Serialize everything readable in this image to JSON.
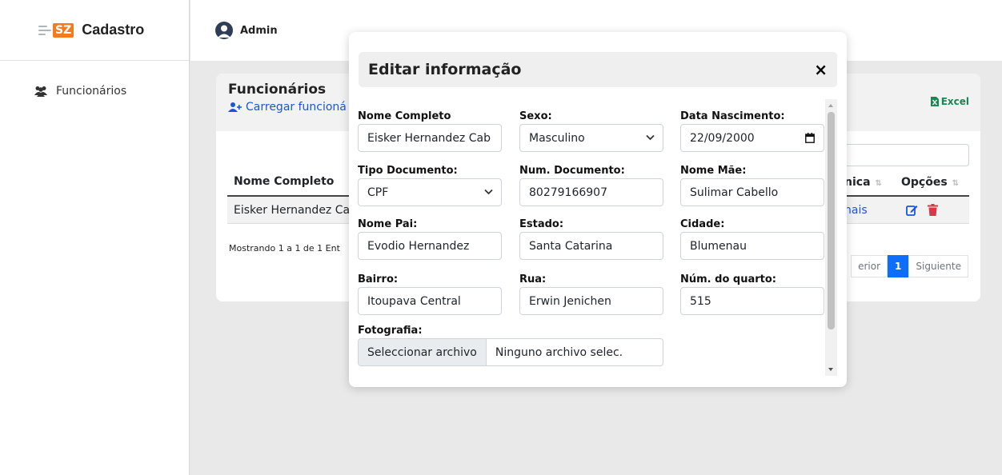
{
  "sidebar": {
    "brand_logo": "SZ",
    "brand_name": "Cadastro",
    "nav_items": [
      {
        "label": "Funcionários",
        "icon": "users-icon"
      }
    ]
  },
  "topbar": {
    "user_label": "Admin"
  },
  "card": {
    "title": "Funcionários",
    "upload_link": "Carregar funcioná",
    "excel_label": "Excel",
    "table": {
      "columns": [
        "Nome Completo",
        "nica",
        "Opções"
      ],
      "rows": [
        {
          "name": "Eisker Hernandez Ca",
          "tecnica": "nais"
        }
      ]
    },
    "info_text": "Mostrando 1 a 1 de 1 Ent",
    "pagination": {
      "previous": "erior",
      "current": "1",
      "next": "Siguiente"
    }
  },
  "modal": {
    "title": "Editar informação",
    "close_symbol": "×",
    "fields": {
      "nome_completo": {
        "label": "Nome Completo",
        "value": "Eisker Hernandez Cab"
      },
      "sexo": {
        "label": "Sexo:",
        "value": "Masculino"
      },
      "data_nascimento": {
        "label": "Data Nascimento:",
        "value": "22/09/2000"
      },
      "tipo_documento": {
        "label": "Tipo Documento:",
        "value": "CPF"
      },
      "num_documento": {
        "label": "Num. Documento:",
        "value": "80279166907"
      },
      "nome_mae": {
        "label": "Nome Mãe:",
        "value": "Sulimar Cabello"
      },
      "nome_pai": {
        "label": "Nome Pai:",
        "value": "Evodio Hernandez"
      },
      "estado": {
        "label": "Estado:",
        "value": "Santa Catarina"
      },
      "cidade": {
        "label": "Cidade:",
        "value": "Blumenau"
      },
      "bairro": {
        "label": "Bairro:",
        "value": "Itoupava Central"
      },
      "rua": {
        "label": "Rua:",
        "value": "Erwin Jenichen"
      },
      "num_quarto": {
        "label": "Núm. do quarto:",
        "value": "515"
      },
      "fotografia": {
        "label": "Fotografia:",
        "button": "Seleccionar archivo",
        "file_text": "Ninguno archivo selec."
      }
    }
  },
  "colors": {
    "accent": "#1a56db",
    "brand": "#f47b20",
    "excel": "#198754",
    "delete": "#dc3545",
    "primary": "#0d6efd"
  }
}
